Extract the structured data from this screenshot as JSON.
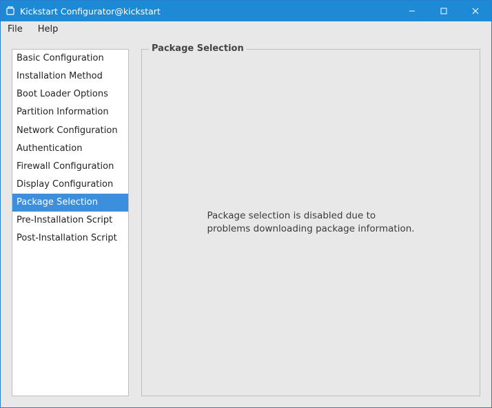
{
  "titlebar": {
    "title": "Kickstart Configurator@kickstart"
  },
  "menu": {
    "file": "File",
    "help": "Help"
  },
  "sidebar": {
    "items": [
      {
        "label": "Basic Configuration",
        "selected": false
      },
      {
        "label": "Installation Method",
        "selected": false
      },
      {
        "label": "Boot Loader Options",
        "selected": false
      },
      {
        "label": "Partition Information",
        "selected": false
      },
      {
        "label": "Network Configuration",
        "selected": false
      },
      {
        "label": "Authentication",
        "selected": false
      },
      {
        "label": "Firewall Configuration",
        "selected": false
      },
      {
        "label": "Display Configuration",
        "selected": false
      },
      {
        "label": "Package Selection",
        "selected": true
      },
      {
        "label": "Pre-Installation Script",
        "selected": false
      },
      {
        "label": "Post-Installation Script",
        "selected": false
      }
    ]
  },
  "panel": {
    "title": "Package Selection",
    "message_line1": "Package selection is disabled due to",
    "message_line2": "problems downloading package information."
  }
}
